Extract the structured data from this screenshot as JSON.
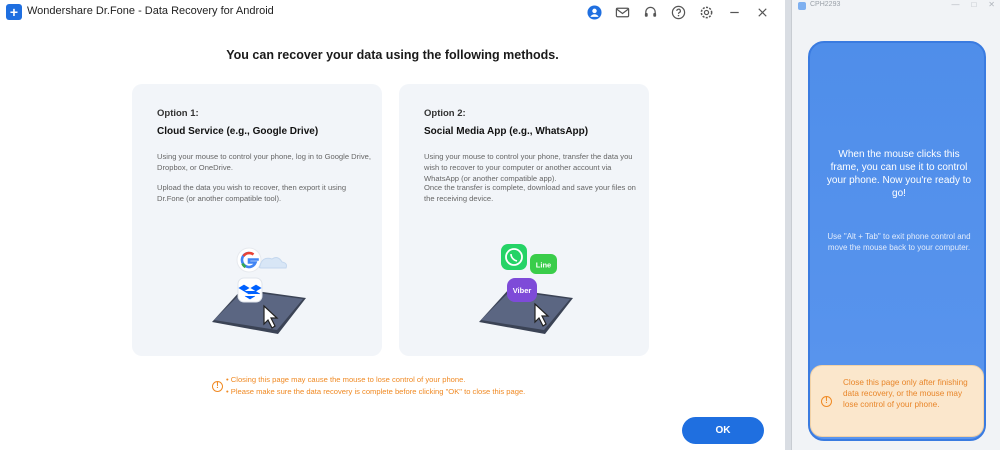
{
  "titlebar": {
    "app_title": "Wondershare Dr.Fone - Data Recovery for Android",
    "icons": [
      "account-icon",
      "mail-icon",
      "headset-icon",
      "help-icon",
      "settings-icon",
      "minimize-icon",
      "close-icon"
    ]
  },
  "headline": "You can recover your data using the following methods.",
  "options": [
    {
      "label": "Option 1:",
      "title": "Cloud Service (e.g., Google Drive)",
      "desc1": "Using your mouse to control your phone, log in to Google Drive, Dropbox, or OneDrive.",
      "desc2": "Upload the data you wish to recover, then export it using Dr.Fone (or another compatible tool)."
    },
    {
      "label": "Option 2:",
      "title": "Social Media App (e.g., WhatsApp)",
      "desc1": "Using your mouse to control your phone, transfer the data you wish to recover to your computer or another account via WhatsApp (or another compatible app).",
      "desc2": "Once the transfer is complete, download and save your files on the receiving device."
    }
  ],
  "illustration_labels": {
    "line": "Line",
    "viber": "Viber"
  },
  "notice": {
    "line1": "• Closing this page may cause the mouse to lose control of your phone.",
    "line2": "• Please make sure the data recovery is complete before clicking \"OK\" to close this page."
  },
  "ok_label": "OK",
  "phone": {
    "window_title": "CPH2293",
    "message": "When the mouse clicks this frame, you can use it to control your phone. Now you're ready to go!",
    "sub": "Use \"Alt + Tab\" to exit phone control and move the mouse back to your computer.",
    "alert": "Close this page only after finishing data recovery, or the mouse may lose control of your phone."
  },
  "colors": {
    "accent": "#1f6fe0",
    "warning": "#f08a24",
    "phone_bg": "#4f8eea"
  }
}
